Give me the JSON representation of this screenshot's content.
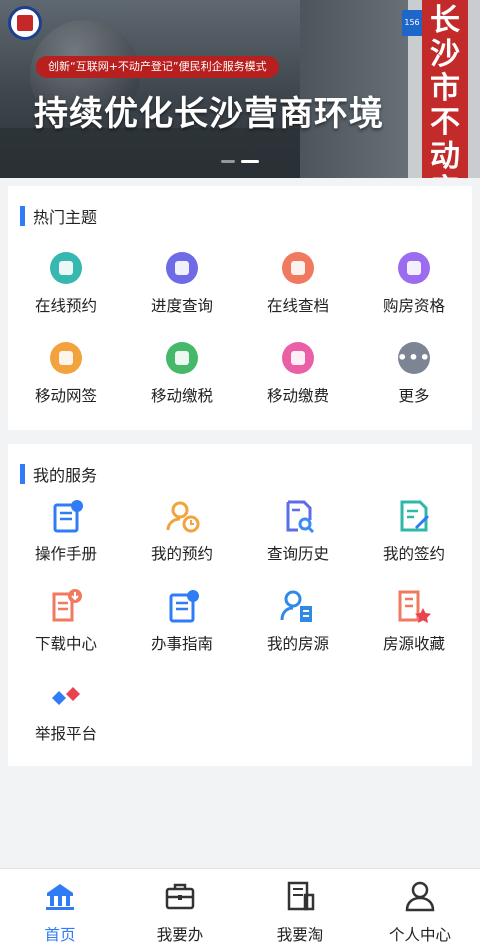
{
  "banner": {
    "campaign_pill": "创新“互联网+不动产登记”便民利企服务模式",
    "headline": "持续优化长沙营商环境",
    "vertical_sign": "长沙市不动产",
    "house_number": "156",
    "slides": 2,
    "active_slide": 2
  },
  "hot_topics": {
    "title": "热门主题",
    "items": [
      {
        "label": "在线预约",
        "icon": "calendar-icon",
        "color": "#36b8b0"
      },
      {
        "label": "进度查询",
        "icon": "search-progress-icon",
        "color": "#6f6ae6"
      },
      {
        "label": "在线查档",
        "icon": "archive-icon",
        "color": "#f07a5f"
      },
      {
        "label": "购房资格",
        "icon": "building-icon",
        "color": "#9b6cf0"
      },
      {
        "label": "移动网签",
        "icon": "mobile-sign-icon",
        "color": "#f2a33d"
      },
      {
        "label": "移动缴税",
        "icon": "mobile-tax-icon",
        "color": "#45b86a"
      },
      {
        "label": "移动缴费",
        "icon": "mobile-pay-icon",
        "color": "#ea5fa6"
      },
      {
        "label": "更多",
        "icon": "more-icon",
        "color": "#7d8494"
      }
    ]
  },
  "my_services": {
    "title": "我的服务",
    "items": [
      {
        "label": "操作手册",
        "icon": "manual-icon",
        "color": "#2f7cf6"
      },
      {
        "label": "我的预约",
        "icon": "user-clock-icon",
        "color": "#f2a33d"
      },
      {
        "label": "查询历史",
        "icon": "doc-search-icon",
        "color": "#5b6de8"
      },
      {
        "label": "我的签约",
        "icon": "doc-sign-icon",
        "color": "#2fb8a8"
      },
      {
        "label": "下载中心",
        "icon": "download-doc-icon",
        "color": "#f07a5f"
      },
      {
        "label": "办事指南",
        "icon": "guide-icon",
        "color": "#2f7cf6"
      },
      {
        "label": "我的房源",
        "icon": "user-building-icon",
        "color": "#2f8ae6"
      },
      {
        "label": "房源收藏",
        "icon": "building-star-icon",
        "color": "#f07a5f"
      },
      {
        "label": "举报平台",
        "icon": "report-icon",
        "color": "#2f7cf6"
      }
    ]
  },
  "tabbar": {
    "items": [
      {
        "label": "首页",
        "icon": "home-icon",
        "active": true
      },
      {
        "label": "我要办",
        "icon": "briefcase-icon",
        "active": false
      },
      {
        "label": "我要淘",
        "icon": "building-search-icon",
        "active": false
      },
      {
        "label": "个人中心",
        "icon": "person-icon",
        "active": false
      }
    ],
    "active_color": "#2f7cf6",
    "inactive_color": "#333333"
  }
}
